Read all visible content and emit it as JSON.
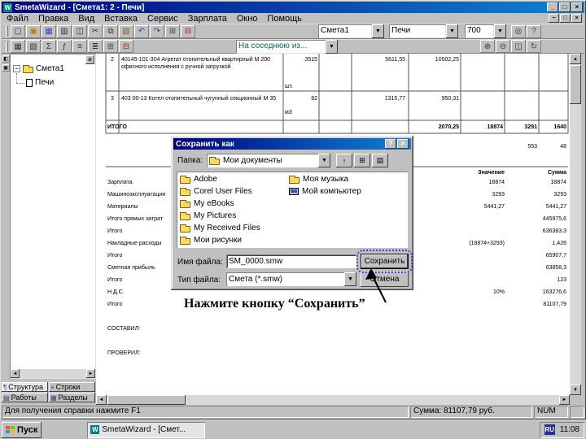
{
  "colors": {
    "titlebar_start": "#000080",
    "titlebar_end": "#1084d0",
    "window_bg": "#c0c0c0",
    "focus_ring": "#3b3bd9",
    "toolbar_combo_text": "#006666"
  },
  "ui": {
    "dropdown_arrow": "▼"
  },
  "scrollbar": {
    "up": "▲",
    "down": "▼",
    "left": "◄",
    "right": "►"
  },
  "window": {
    "title": "SmetaWizard - [Смета1: 2 - Печи]",
    "icon_letter": "W",
    "controls": {
      "minimize": "_",
      "maximize": "□",
      "close": "×"
    },
    "mdi_controls": {
      "minimize": "−",
      "restore": "□",
      "close": "×"
    }
  },
  "menu": {
    "items": [
      "Файл",
      "Правка",
      "Вид",
      "Вставка",
      "Сервис",
      "Зарплата",
      "Окно",
      "Помощь"
    ]
  },
  "toolbars": {
    "row1": {
      "icons_left": [
        {
          "name": "new-icon",
          "glyph": "▢",
          "color": "#333333"
        },
        {
          "name": "open-icon",
          "glyph": "▣",
          "color": "#c08000"
        },
        {
          "name": "save-icon",
          "glyph": "▦",
          "color": "#3050c8"
        },
        {
          "name": "print-icon",
          "glyph": "▥",
          "color": "#333333"
        },
        {
          "name": "print-preview-icon",
          "glyph": "◫",
          "color": "#333333"
        },
        {
          "name": "cut-icon",
          "glyph": "✂",
          "color": "#333333"
        },
        {
          "name": "copy-icon",
          "glyph": "⧉",
          "color": "#333333"
        },
        {
          "name": "paste-icon",
          "glyph": "▨",
          "color": "#806030"
        },
        {
          "name": "undo-icon",
          "glyph": "↶",
          "color": "#205080"
        },
        {
          "name": "redo-icon",
          "glyph": "↷",
          "color": "#205080"
        },
        {
          "name": "insert-row-icon",
          "glyph": "⊞",
          "color": "#206020"
        },
        {
          "name": "delete-row-icon",
          "glyph": "⊟",
          "color": "#a02020"
        }
      ],
      "combo_estimate": "Смета1",
      "combo_chapter": "Печи",
      "combo_zoom": "700",
      "icons_right": [
        {
          "name": "find-icon",
          "glyph": "◎",
          "color": "#333333"
        },
        {
          "name": "help-icon",
          "glyph": "?",
          "color": "#205080"
        }
      ]
    },
    "row2": {
      "icons_left": [
        {
          "name": "table-icon",
          "glyph": "▦",
          "color": "#333333"
        },
        {
          "name": "borders-icon",
          "glyph": "▧",
          "color": "#333333"
        },
        {
          "name": "sum-icon",
          "glyph": "Σ",
          "color": "#333333"
        },
        {
          "name": "function-icon",
          "glyph": "ƒ",
          "color": "#333333"
        },
        {
          "name": "align-left-icon",
          "glyph": "≡",
          "color": "#333333"
        },
        {
          "name": "align-justify-icon",
          "glyph": "≣",
          "color": "#333333"
        },
        {
          "name": "insert-cell-icon",
          "glyph": "⊞",
          "color": "#206020"
        },
        {
          "name": "delete-cell-icon",
          "glyph": "⊟",
          "color": "#a02020"
        }
      ],
      "combo_value": "На соседнюю из...",
      "icons_right": [
        {
          "name": "zoom-in-icon",
          "glyph": "⊕",
          "color": "#333333"
        },
        {
          "name": "zoom-out-icon",
          "glyph": "⊖",
          "color": "#333333"
        },
        {
          "name": "page-setup-icon",
          "glyph": "◫",
          "color": "#333333"
        },
        {
          "name": "refresh-icon",
          "glyph": "↻",
          "color": "#206020"
        }
      ]
    }
  },
  "left_strip": {
    "icons": [
      {
        "name": "panel-toggle-icon",
        "glyph": "◧"
      },
      {
        "name": "panel-pin-icon",
        "glyph": "▣"
      }
    ]
  },
  "sidebar": {
    "tree": [
      {
        "label": "Смета1"
      },
      {
        "label": "Печи"
      }
    ]
  },
  "bottom_tabs": [
    {
      "label": "Структура",
      "glyph": "¶",
      "icon_name": "structure-tab-icon"
    },
    {
      "label": "Строки",
      "glyph": "≡",
      "icon_name": "rows-tab-icon"
    },
    {
      "label": "Работы",
      "glyph": "▤",
      "icon_name": "works-tab-icon"
    },
    {
      "label": "Разделы",
      "glyph": "▦",
      "icon_name": "sections-tab-icon"
    }
  ],
  "document": {
    "top_table": {
      "rows": [
        {
          "num": "2",
          "code_desc": "40145-101-304  Агрегат отопительный квартирный М 200 офисного исполнения с ручной загрузкой",
          "unit": "шт.",
          "qty": "3515",
          "price": "5611,55",
          "sum": "10502,25"
        },
        {
          "num": "3",
          "code_desc": "403 00-13  Котел отопительный чугунный секционный М 35",
          "unit": "м3",
          "qty": "82",
          "price": "1315,77",
          "sum": "950,31"
        }
      ],
      "itogo": {
        "label": "ИТОГО",
        "values": [
          "2070,25",
          "18874",
          "3291",
          "1640"
        ]
      },
      "sub_values": [
        "553",
        "48"
      ]
    },
    "summary": {
      "headers": [
        "Значение",
        "Сумма"
      ],
      "rows": [
        {
          "label": "Зарплата",
          "mid": "18874",
          "value": "18874"
        },
        {
          "label": "Машиноэксплуатация",
          "mid": "3293",
          "value": "3293"
        },
        {
          "label": "Материалы",
          "mid": "5441,27",
          "value": "5441,27"
        },
        {
          "label": "Итого прямых затрат",
          "mid": "",
          "value": "445975,6"
        },
        {
          "label": "Итого",
          "mid": "",
          "value": "636383,3"
        },
        {
          "label": "Накладные расходы",
          "mid": "(18874+3293)",
          "value": "1,426"
        },
        {
          "label": "Итого",
          "mid": "",
          "value": "65907,7"
        },
        {
          "label": "Сметная прибыль",
          "mid": "",
          "value": "63858,3"
        },
        {
          "label": "Итого",
          "mid": "",
          "value": "123"
        },
        {
          "label": "Н.Д.С.",
          "mid": "10%",
          "value": "163276,6"
        },
        {
          "label": "Итого",
          "mid": "",
          "value": "81107,79"
        },
        {
          "label": "",
          "mid": "",
          "value": ""
        },
        {
          "label": "СОСТАВИЛ:",
          "mid": "",
          "value": ""
        },
        {
          "label": "",
          "mid": "",
          "value": ""
        },
        {
          "label": "ПРОВЕРИЛ:",
          "mid": "",
          "value": ""
        }
      ]
    }
  },
  "dialog": {
    "title": "Сохранить как",
    "buttons": {
      "help": "?",
      "close": "×"
    },
    "folder_label": "Папка:",
    "folder_value": "Мои документы",
    "toolbar_icons": [
      {
        "name": "up-one-level-icon",
        "glyph": "↑"
      },
      {
        "name": "create-new-folder-icon",
        "glyph": "⊞"
      },
      {
        "name": "view-menu-icon",
        "glyph": "▤"
      }
    ],
    "files": [
      {
        "label": "Adobe",
        "icon": "folder"
      },
      {
        "label": "Corel User Files",
        "icon": "folder"
      },
      {
        "label": "My eBooks",
        "icon": "folder"
      },
      {
        "label": "My Pictures",
        "icon": "folder"
      },
      {
        "label": "My Received Files",
        "icon": "folder"
      },
      {
        "label": "Мои рисунки",
        "icon": "folder"
      },
      {
        "label": "Моя музыка",
        "icon": "folder"
      },
      {
        "label": "Мой компьютер",
        "icon": "computer"
      }
    ],
    "filename_label": "Имя файла:",
    "filename_value": "SM_0000.smw",
    "filetype_label": "Тип файла:",
    "filetype_value": "Смета (*.smw)",
    "save_label": "Сохранить",
    "cancel_label": "Отмена"
  },
  "annotation": {
    "text": "Нажмите кнопку “Сохранить”"
  },
  "statusbar": {
    "help": "Для получения справки нажмите F1",
    "sum": "Сумма: 81107,79 руб.",
    "num": "NUM"
  },
  "taskbar": {
    "start_label": "Пуск",
    "task_label": "SmetaWizard - [Смет...",
    "lang": "RU",
    "time": "11:08"
  }
}
